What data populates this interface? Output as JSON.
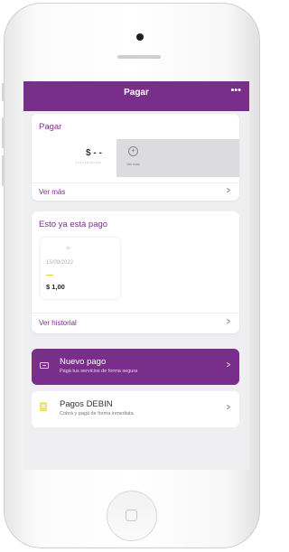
{
  "header": {
    "title": "Pagar",
    "more": "•••"
  },
  "pagar_card": {
    "title": "Pagar",
    "amount": "$ - -",
    "amount_dots": "••••••••••••",
    "add_tile_label": "Ver más",
    "link": "Ver más"
  },
  "paid_card": {
    "title": "Esto ya está pago",
    "item": {
      "date": "15/09/2022",
      "amount": "$ 1,00"
    },
    "link": "Ver historial"
  },
  "new_payment": {
    "title": "Nuevo pago",
    "subtitle": "Pagá tus servicios de forma segura"
  },
  "debin": {
    "title": "Pagos DEBIN",
    "subtitle": "Cobrá y pagá de forma inmediata"
  },
  "colors": {
    "accent": "#7a2e8c",
    "background": "#efeff1",
    "debin_icon": "#f1e36f"
  },
  "icons": {
    "more": "more-icon",
    "add": "plus-icon",
    "wallet": "wallet-icon",
    "document": "document-icon",
    "chevron": "chevron-right-icon"
  }
}
